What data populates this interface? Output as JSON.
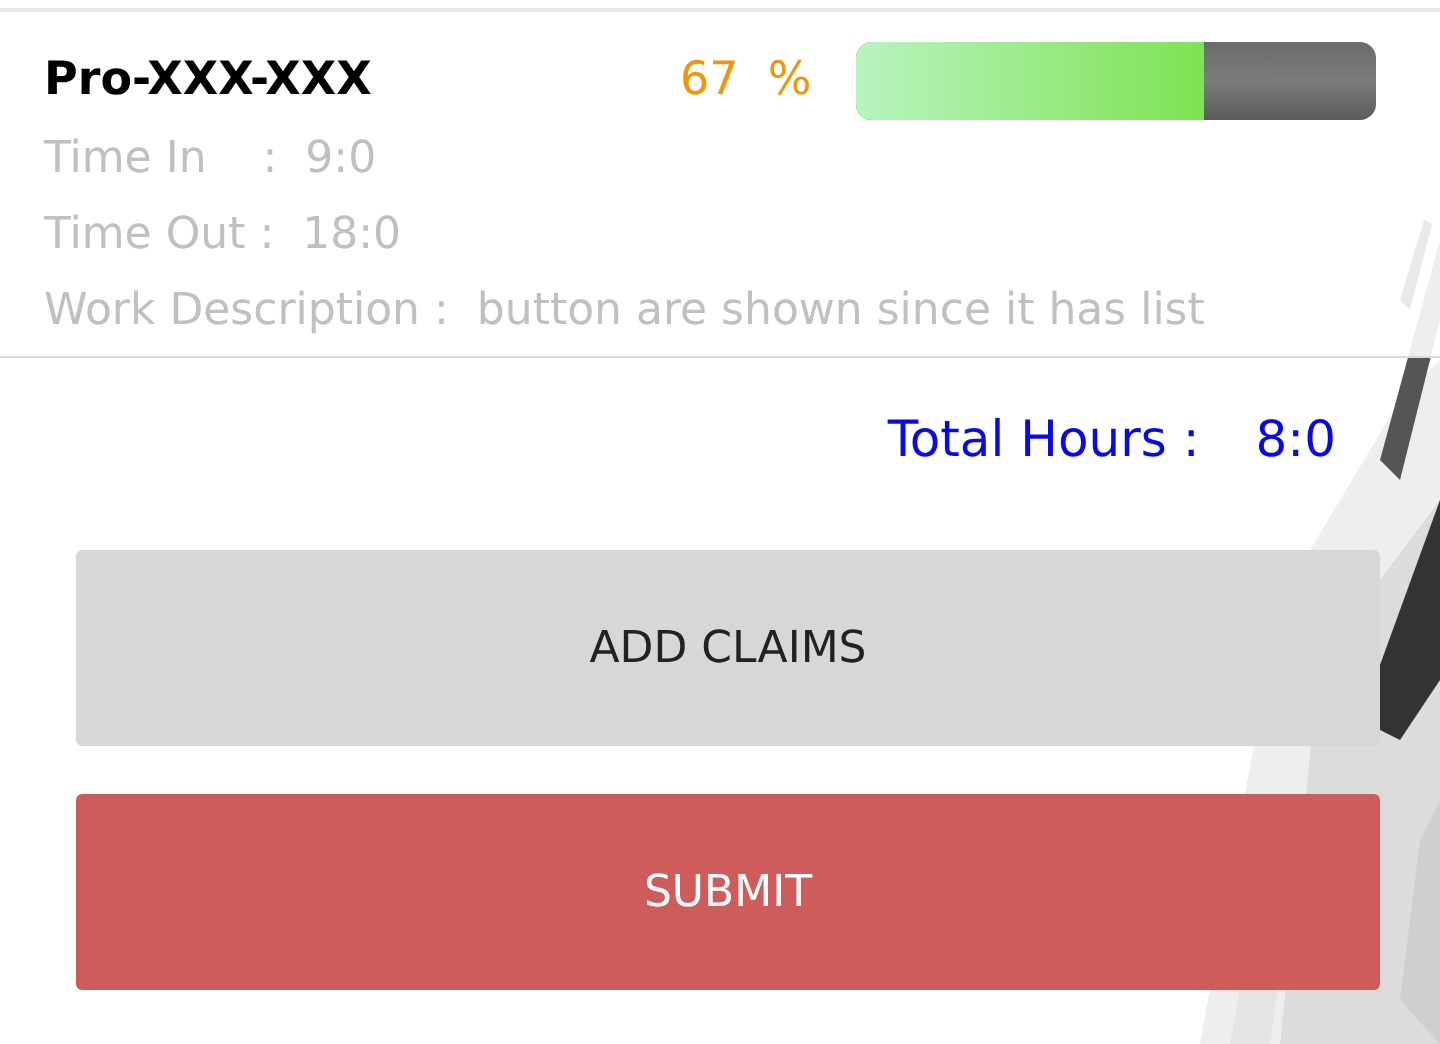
{
  "project": {
    "code": "Pro-XXX-XXX",
    "percent": "67  %",
    "level": 0.67,
    "details": [
      {
        "label": "Time In    :",
        "value": "9:0"
      },
      {
        "label": "Time Out :",
        "value": "18:0"
      },
      {
        "label": "Work Description :",
        "value": "button are shown since it has list"
      }
    ]
  },
  "total": {
    "label": "Total Hours :",
    "value": "8:0"
  },
  "buttons": [
    {
      "label": "ADD CLAIMS",
      "kind": "secondary"
    },
    {
      "label": "SUBMIT",
      "kind": "primary"
    }
  ]
}
